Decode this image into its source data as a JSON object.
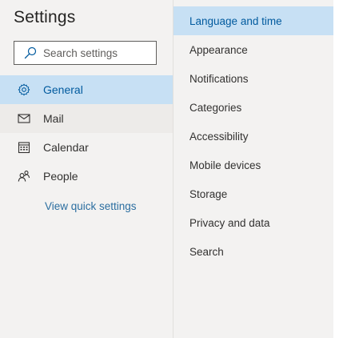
{
  "header": {
    "title": "Settings"
  },
  "search": {
    "placeholder": "Search settings",
    "value": ""
  },
  "nav": {
    "items": [
      {
        "label": "General",
        "icon": "gear-icon",
        "selected": true
      },
      {
        "label": "Mail",
        "icon": "mail-icon",
        "selected": false
      },
      {
        "label": "Calendar",
        "icon": "calendar-icon",
        "selected": false
      },
      {
        "label": "People",
        "icon": "people-icon",
        "selected": false
      }
    ],
    "quick_settings_link": "View quick settings"
  },
  "sub_nav": {
    "items": [
      {
        "label": "Language and time",
        "selected": true
      },
      {
        "label": "Appearance",
        "selected": false
      },
      {
        "label": "Notifications",
        "selected": false
      },
      {
        "label": "Categories",
        "selected": false
      },
      {
        "label": "Accessibility",
        "selected": false
      },
      {
        "label": "Mobile devices",
        "selected": false
      },
      {
        "label": "Storage",
        "selected": false
      },
      {
        "label": "Privacy and data",
        "selected": false
      },
      {
        "label": "Search",
        "selected": false
      }
    ]
  },
  "colors": {
    "accent": "#005a9e",
    "selected_bg": "#c7e0f4",
    "pane_bg": "#f3f2f1",
    "link": "#2b6ea0"
  }
}
